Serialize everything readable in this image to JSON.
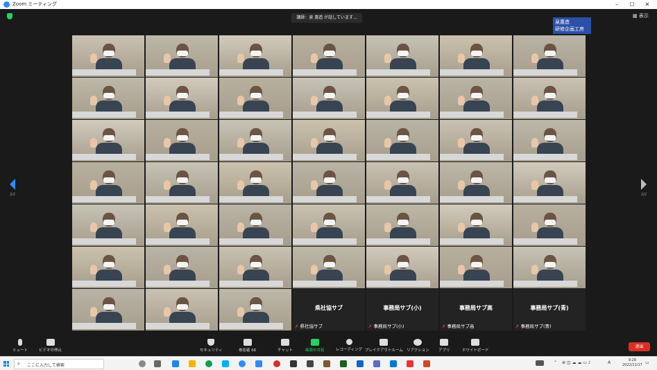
{
  "window": {
    "title": "Zoom ミーティング",
    "controls": [
      "–",
      "☐",
      "✕"
    ]
  },
  "speaking_indicator": "講師：泉 惠造 が話しています...",
  "view_button": "表示",
  "overlay_label": [
    "泉惠造",
    "研修企画工房"
  ],
  "pagination": {
    "left": "2/2",
    "right": "2/2"
  },
  "name_tiles": [
    {
      "big": "県社協サブ",
      "small": "県社協サブ"
    },
    {
      "big": "事務局サブ(小)",
      "small": "事務局サブ(小)"
    },
    {
      "big": "事務局サブ高",
      "small": "事務局サブ高"
    },
    {
      "big": "事務局サブ(青)",
      "small": "事務局サブ(青)"
    }
  ],
  "toolbar": {
    "mute": "ミュート",
    "video_stop": "ビデオの停止",
    "security": "セキュリティ",
    "participants": "参加者",
    "participants_count": "66",
    "chat": "チャット",
    "share_screen": "画面の共有",
    "recording": "レコーディング",
    "breakout": "ブレイクアウトルーム",
    "reactions": "リアクション",
    "apps": "アプリ",
    "whiteboard": "ホワイトボード",
    "leave": "退出"
  },
  "taskbar": {
    "search_placeholder": "ここに入力して検索",
    "ime": "A",
    "time": "9:28",
    "date": "2022/11/17"
  },
  "colors": {
    "accent": "#2d8cff",
    "leave": "#d93025",
    "share": "#23d160",
    "overlay": "#2c4fa8"
  }
}
